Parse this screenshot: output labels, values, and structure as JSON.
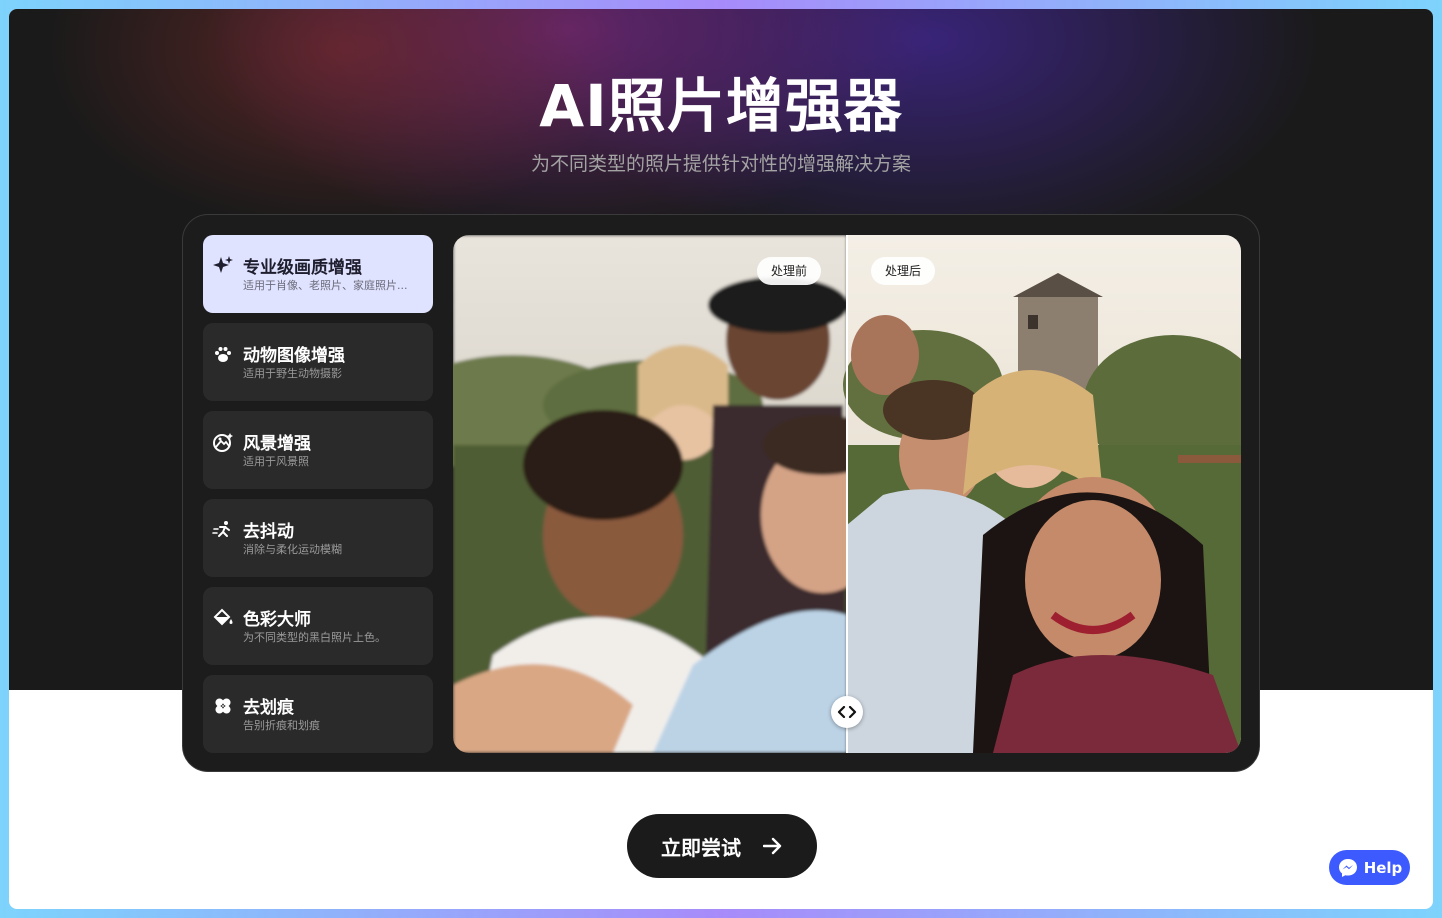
{
  "hero": {
    "title": "AI照片增强器",
    "subtitle": "为不同类型的照片提供针对性的增强解决方案"
  },
  "categories": [
    {
      "name": "专业级画质增强",
      "desc": "适用于肖像、老照片、家庭照片...",
      "icon": "sparkle-icon",
      "active": true
    },
    {
      "name": "动物图像增强",
      "desc": "适用于野生动物摄影",
      "icon": "paw-icon",
      "active": false
    },
    {
      "name": "风景增强",
      "desc": "适用于风景照",
      "icon": "landscape-icon",
      "active": false
    },
    {
      "name": "去抖动",
      "desc": "消除与柔化运动模糊",
      "icon": "motion-icon",
      "active": false
    },
    {
      "name": "色彩大师",
      "desc": "为不同类型的黑白照片上色。",
      "icon": "paint-bucket-icon",
      "active": false
    },
    {
      "name": "去划痕",
      "desc": "告别折痕和划痕",
      "icon": "bandage-icon",
      "active": false
    }
  ],
  "compare": {
    "before_label": "处理前",
    "after_label": "处理后",
    "slider_position": 0.5
  },
  "cta": {
    "label": "立即尝试"
  },
  "help": {
    "label": "Help"
  },
  "colors": {
    "accent": "#e0e3ff",
    "help_blue": "#3d5afe",
    "hero_bg": "#1a1a1a"
  }
}
